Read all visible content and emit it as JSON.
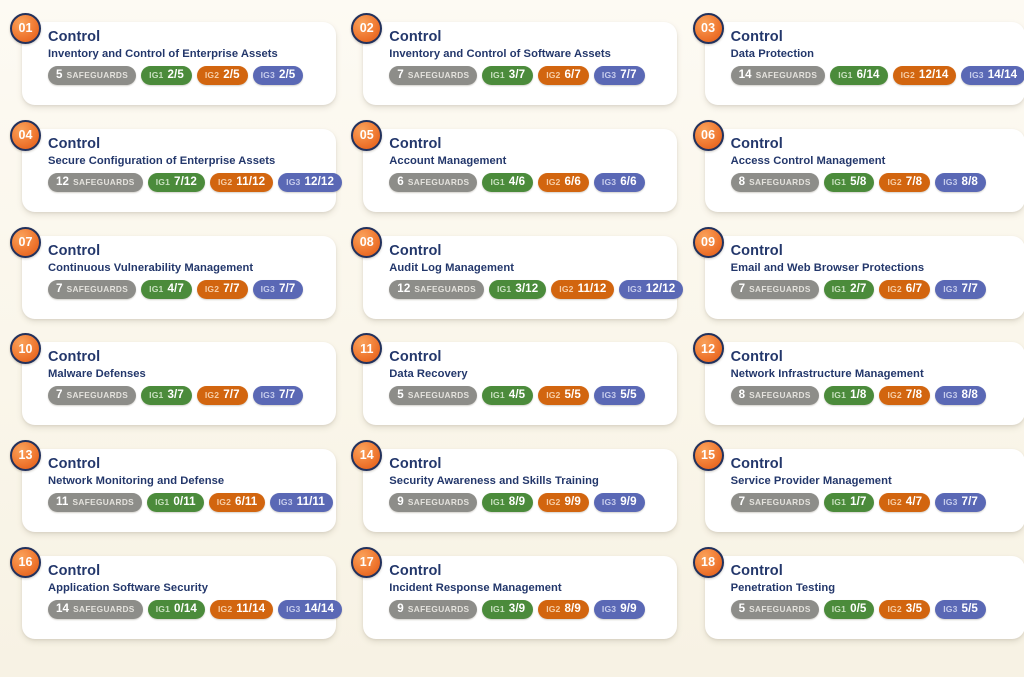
{
  "meta": {
    "background_color": "#faf6ea",
    "card_color": "#ffffff",
    "badge_color": "#ea6c26",
    "badge_border_color": "#22315c",
    "title_color": "#23376b",
    "chip_colors": {
      "safeguards": "#8d8d89",
      "ig1": "#4b8b3b",
      "ig2": "#d2650f",
      "ig3": "#5a68b5"
    }
  },
  "labels": {
    "control": "Control",
    "safeguards": "SAFEGUARDS",
    "ig1": "IG1",
    "ig2": "IG2",
    "ig3": "IG3"
  },
  "cards": [
    {
      "number": "01",
      "control": "Control",
      "name": "Inventory and Control of Enterprise Assets",
      "safeguards_count": "5",
      "safeguards_label": "SAFEGUARDS",
      "ig1_label": "IG1",
      "ig1_value": "2/5",
      "ig2_label": "IG2",
      "ig2_value": "2/5",
      "ig3_label": "IG3",
      "ig3_value": "2/5"
    },
    {
      "number": "02",
      "control": "Control",
      "name": "Inventory and Control of Software Assets",
      "safeguards_count": "7",
      "safeguards_label": "SAFEGUARDS",
      "ig1_label": "IG1",
      "ig1_value": "3/7",
      "ig2_label": "IG2",
      "ig2_value": "6/7",
      "ig3_label": "IG3",
      "ig3_value": "7/7"
    },
    {
      "number": "03",
      "control": "Control",
      "name": "Data Protection",
      "safeguards_count": "14",
      "safeguards_label": "SAFEGUARDS",
      "ig1_label": "IG1",
      "ig1_value": "6/14",
      "ig2_label": "IG2",
      "ig2_value": "12/14",
      "ig3_label": "IG3",
      "ig3_value": "14/14"
    },
    {
      "number": "04",
      "control": "Control",
      "name": "Secure Configuration of Enterprise Assets",
      "safeguards_count": "12",
      "safeguards_label": "SAFEGUARDS",
      "ig1_label": "IG1",
      "ig1_value": "7/12",
      "ig2_label": "IG2",
      "ig2_value": "11/12",
      "ig3_label": "IG3",
      "ig3_value": "12/12"
    },
    {
      "number": "05",
      "control": "Control",
      "name": "Account Management",
      "safeguards_count": "6",
      "safeguards_label": "SAFEGUARDS",
      "ig1_label": "IG1",
      "ig1_value": "4/6",
      "ig2_label": "IG2",
      "ig2_value": "6/6",
      "ig3_label": "IG3",
      "ig3_value": "6/6"
    },
    {
      "number": "06",
      "control": "Control",
      "name": "Access Control Management",
      "safeguards_count": "8",
      "safeguards_label": "SAFEGUARDS",
      "ig1_label": "IG1",
      "ig1_value": "5/8",
      "ig2_label": "IG2",
      "ig2_value": "7/8",
      "ig3_label": "IG3",
      "ig3_value": "8/8"
    },
    {
      "number": "07",
      "control": "Control",
      "name": "Continuous Vulnerability Management",
      "safeguards_count": "7",
      "safeguards_label": "SAFEGUARDS",
      "ig1_label": "IG1",
      "ig1_value": "4/7",
      "ig2_label": "IG2",
      "ig2_value": "7/7",
      "ig3_label": "IG3",
      "ig3_value": "7/7"
    },
    {
      "number": "08",
      "control": "Control",
      "name": "Audit Log Management",
      "safeguards_count": "12",
      "safeguards_label": "SAFEGUARDS",
      "ig1_label": "IG1",
      "ig1_value": "3/12",
      "ig2_label": "IG2",
      "ig2_value": "11/12",
      "ig3_label": "IG3",
      "ig3_value": "12/12"
    },
    {
      "number": "09",
      "control": "Control",
      "name": "Email and Web Browser Protections",
      "safeguards_count": "7",
      "safeguards_label": "SAFEGUARDS",
      "ig1_label": "IG1",
      "ig1_value": "2/7",
      "ig2_label": "IG2",
      "ig2_value": "6/7",
      "ig3_label": "IG3",
      "ig3_value": "7/7"
    },
    {
      "number": "10",
      "control": "Control",
      "name": "Malware Defenses",
      "safeguards_count": "7",
      "safeguards_label": "SAFEGUARDS",
      "ig1_label": "IG1",
      "ig1_value": "3/7",
      "ig2_label": "IG2",
      "ig2_value": "7/7",
      "ig3_label": "IG3",
      "ig3_value": "7/7"
    },
    {
      "number": "11",
      "control": "Control",
      "name": "Data Recovery",
      "safeguards_count": "5",
      "safeguards_label": "SAFEGUARDS",
      "ig1_label": "IG1",
      "ig1_value": "4/5",
      "ig2_label": "IG2",
      "ig2_value": "5/5",
      "ig3_label": "IG3",
      "ig3_value": "5/5"
    },
    {
      "number": "12",
      "control": "Control",
      "name": "Network Infrastructure Management",
      "safeguards_count": "8",
      "safeguards_label": "SAFEGUARDS",
      "ig1_label": "IG1",
      "ig1_value": "1/8",
      "ig2_label": "IG2",
      "ig2_value": "7/8",
      "ig3_label": "IG3",
      "ig3_value": "8/8"
    },
    {
      "number": "13",
      "control": "Control",
      "name": "Network Monitoring and Defense",
      "safeguards_count": "11",
      "safeguards_label": "SAFEGUARDS",
      "ig1_label": "IG1",
      "ig1_value": "0/11",
      "ig2_label": "IG2",
      "ig2_value": "6/11",
      "ig3_label": "IG3",
      "ig3_value": "11/11"
    },
    {
      "number": "14",
      "control": "Control",
      "name": "Security Awareness and Skills Training",
      "safeguards_count": "9",
      "safeguards_label": "SAFEGUARDS",
      "ig1_label": "IG1",
      "ig1_value": "8/9",
      "ig2_label": "IG2",
      "ig2_value": "9/9",
      "ig3_label": "IG3",
      "ig3_value": "9/9"
    },
    {
      "number": "15",
      "control": "Control",
      "name": "Service Provider Management",
      "safeguards_count": "7",
      "safeguards_label": "SAFEGUARDS",
      "ig1_label": "IG1",
      "ig1_value": "1/7",
      "ig2_label": "IG2",
      "ig2_value": "4/7",
      "ig3_label": "IG3",
      "ig3_value": "7/7"
    },
    {
      "number": "16",
      "control": "Control",
      "name": "Application Software Security",
      "safeguards_count": "14",
      "safeguards_label": "SAFEGUARDS",
      "ig1_label": "IG1",
      "ig1_value": "0/14",
      "ig2_label": "IG2",
      "ig2_value": "11/14",
      "ig3_label": "IG3",
      "ig3_value": "14/14"
    },
    {
      "number": "17",
      "control": "Control",
      "name": "Incident Response Management",
      "safeguards_count": "9",
      "safeguards_label": "SAFEGUARDS",
      "ig1_label": "IG1",
      "ig1_value": "3/9",
      "ig2_label": "IG2",
      "ig2_value": "8/9",
      "ig3_label": "IG3",
      "ig3_value": "9/9"
    },
    {
      "number": "18",
      "control": "Control",
      "name": "Penetration Testing",
      "safeguards_count": "5",
      "safeguards_label": "SAFEGUARDS",
      "ig1_label": "IG1",
      "ig1_value": "0/5",
      "ig2_label": "IG2",
      "ig2_value": "3/5",
      "ig3_label": "IG3",
      "ig3_value": "5/5"
    }
  ]
}
